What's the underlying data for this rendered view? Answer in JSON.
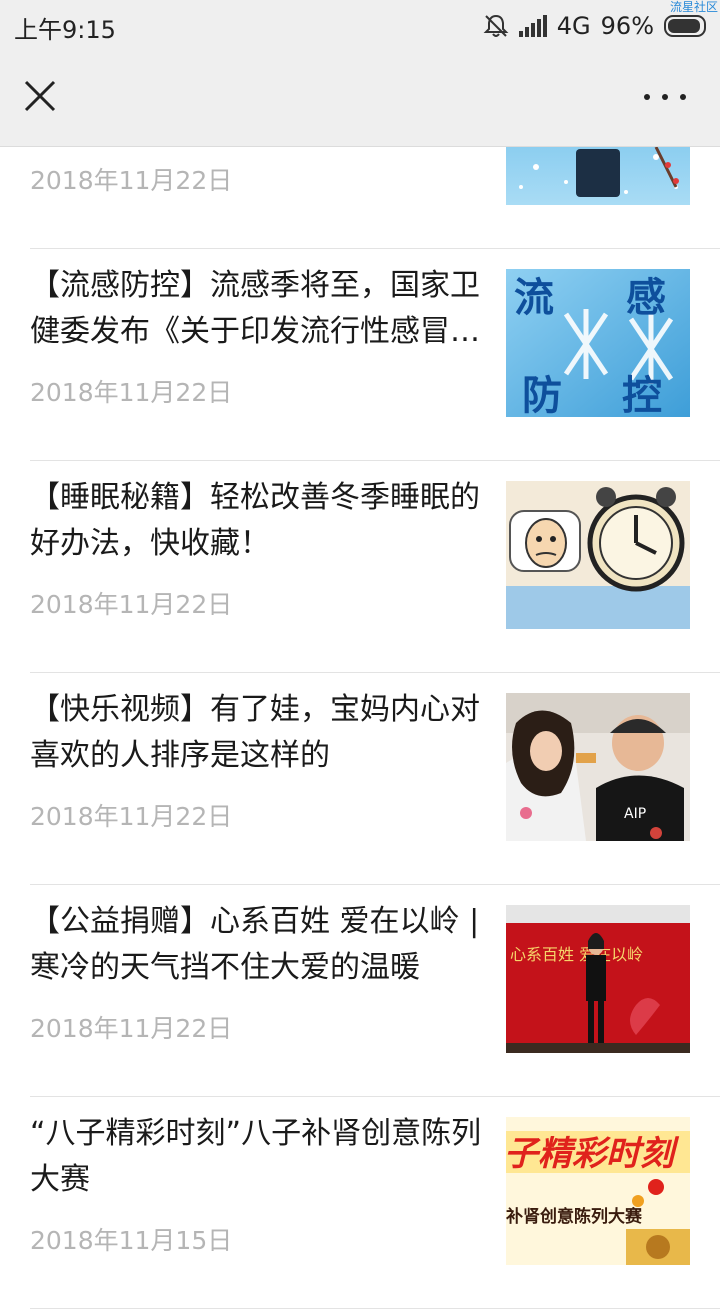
{
  "status_bar": {
    "time": "上午9:15",
    "network": "4G",
    "battery": "96%",
    "watermark": "流星社区"
  },
  "title_bar": {
    "close_icon": "close-icon",
    "more_icon": "more-icon"
  },
  "articles": [
    {
      "title": "",
      "date": "2018年11月22日"
    },
    {
      "title": "【流感防控】流感季将至，国家卫健委发布《关于印发流行性感冒诊疗方案》",
      "date": "2018年11月22日",
      "thumb_text": [
        "流",
        "感",
        "防",
        "控"
      ]
    },
    {
      "title": "【睡眠秘籍】轻松改善冬季睡眠的好办法，快收藏！",
      "date": "2018年11月22日"
    },
    {
      "title": "【快乐视频】有了娃，宝妈内心对喜欢的人排序是这样的",
      "date": "2018年11月22日"
    },
    {
      "title": "【公益捐赠】心系百姓 爱在以岭 | 寒冷的天气挡不住大爱的温暖",
      "date": "2018年11月22日",
      "thumb_text": "心系百姓 爱在以岭"
    },
    {
      "title": "“八子精彩时刻”八子补肾创意陈列大赛",
      "date": "2018年11月15日",
      "thumb_text": [
        "子精彩时刻",
        "补肾创意陈列大赛"
      ]
    }
  ],
  "colors": {
    "bar_background": "#efefef",
    "date_text": "#b5b5b5",
    "divider": "#e3e3e3"
  }
}
